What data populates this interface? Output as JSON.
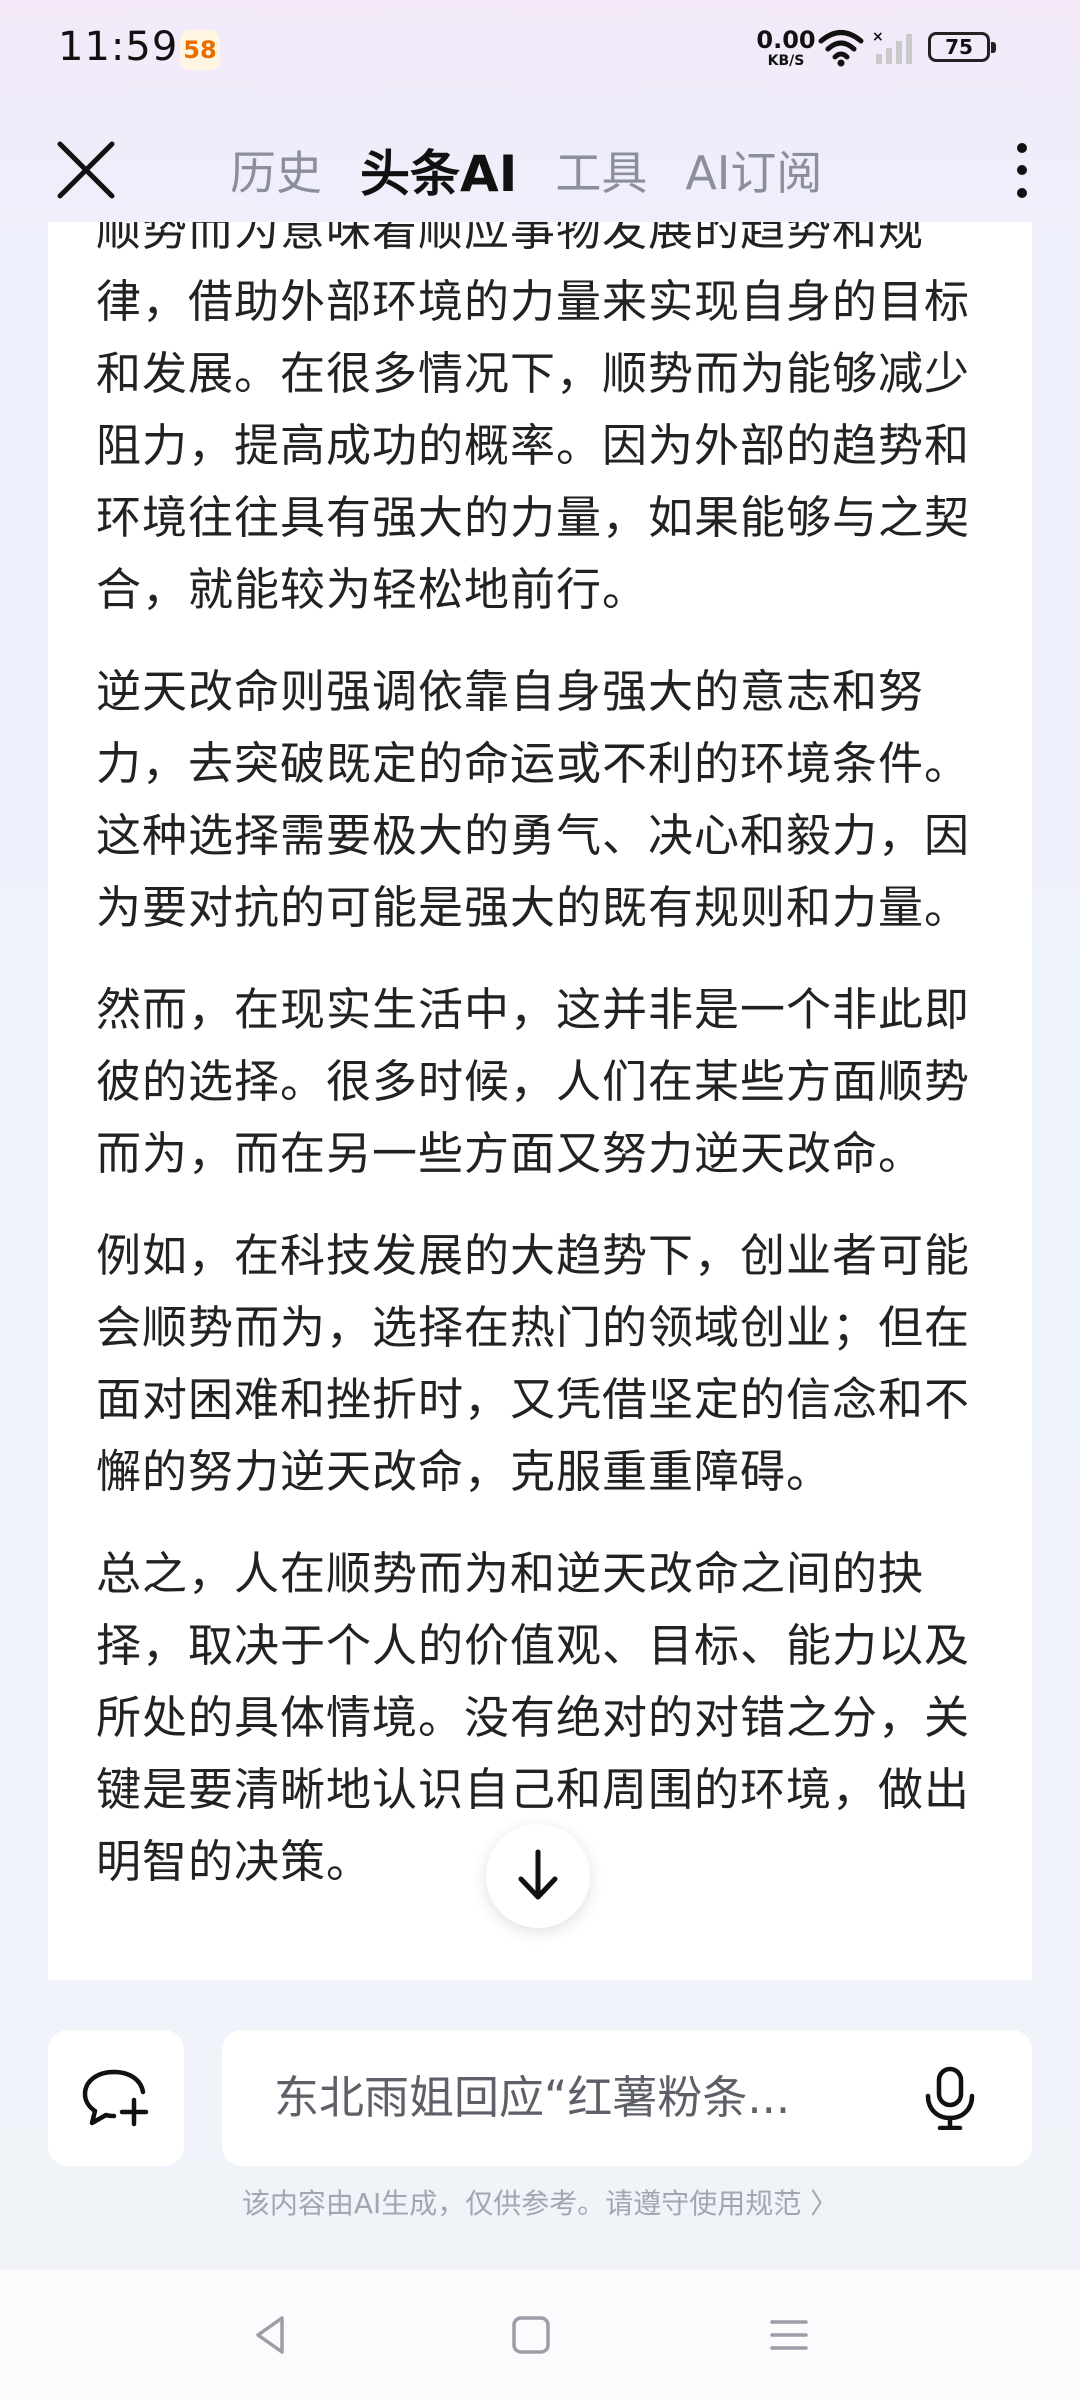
{
  "status_bar": {
    "time": "11:59",
    "app_badge": "58",
    "net_speed_value": "0.00",
    "net_speed_unit": "KB/S",
    "battery": "75"
  },
  "nav": {
    "tabs": [
      {
        "label": "历史",
        "active": false
      },
      {
        "label": "头条AI",
        "active": true
      },
      {
        "label": "工具",
        "active": false
      },
      {
        "label": "AI订阅",
        "active": false
      }
    ]
  },
  "content": {
    "paragraphs": [
      "顺势而为意味着顺应事物发展的趋势和规律，借助外部环境的力量来实现自身的目标和发展。在很多情况下，顺势而为能够减少阻力，提高成功的概率。因为外部的趋势和环境往往具有强大的力量，如果能够与之契合，就能较为轻松地前行。",
      "逆天改命则强调依靠自身强大的意志和努力，去突破既定的命运或不利的环境条件。这种选择需要极大的勇气、决心和毅力，因为要对抗的可能是强大的既有规则和力量。",
      "然而，在现实生活中，这并非是一个非此即彼的选择。很多时候，人们在某些方面顺势而为，而在另一些方面又努力逆天改命。",
      "例如，在科技发展的大趋势下，创业者可能会顺势而为，选择在热门的领域创业；但在面对困难和挫折时，又凭借坚定的信念和不懈的努力逆天改命，克服重重障碍。",
      "总之，人在顺势而为和逆天改命之间的抉择，取决于个人的价值观、目标、能力以及所处的具体情境。没有绝对的对错之分，关键是要清晰地认识自己和周围的环境，做出明智的决策。"
    ]
  },
  "input": {
    "query_text": "东北雨姐回应“红薯粉条..."
  },
  "footer": {
    "disclaimer": "该内容由AI生成，仅供参考。请遵守使用规范 〉"
  }
}
